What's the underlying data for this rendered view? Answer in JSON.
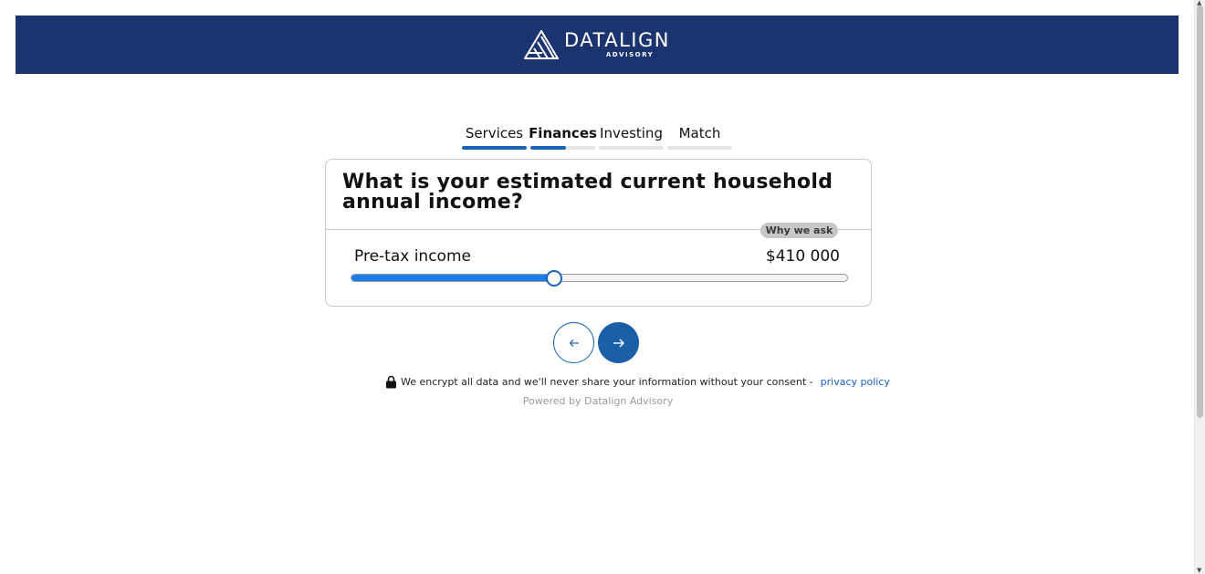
{
  "brand": {
    "name": "DATALIGN",
    "sub": "ADVISORY",
    "header_color": "#1b3470"
  },
  "steps": [
    {
      "label": "Services",
      "active": false,
      "progress": 1.0
    },
    {
      "label": "Finances",
      "active": true,
      "progress": 0.55
    },
    {
      "label": "Investing",
      "active": false,
      "progress": 0.0
    },
    {
      "label": "Match",
      "active": false,
      "progress": 0.0
    }
  ],
  "question": "What is your estimated current household annual income?",
  "why_ask": "Why we ask",
  "field": {
    "label": "Pre-tax income",
    "value": "$410 000",
    "slider_fraction": 0.41
  },
  "nav": {
    "back_icon": "arrow-left-icon",
    "next_icon": "arrow-right-icon",
    "accent": "#1a63b8"
  },
  "footer": {
    "security_text": "We encrypt all data and we'll never share your information without your consent -",
    "privacy_link": "privacy policy",
    "powered_by": "Powered by Datalign Advisory"
  }
}
